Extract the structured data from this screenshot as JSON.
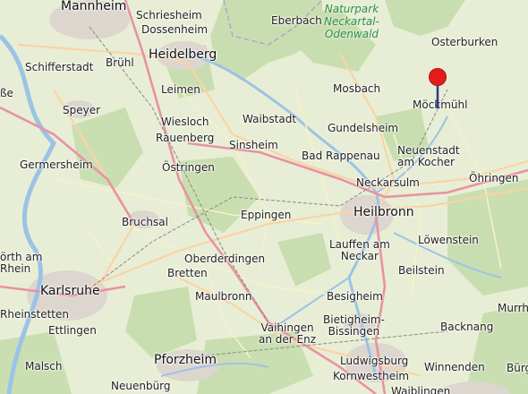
{
  "places": {
    "mannheim": "Mannheim",
    "schriesheim": "Schriesheim",
    "dossenheim": "Dossenheim",
    "eberbach": "Eberbach",
    "osterburken": "Osterburken",
    "heidelberg": "Heidelberg",
    "schifferstadt": "Schifferstadt",
    "bruehl": "Brühl",
    "leimen": "Leimen",
    "mosbach": "Mosbach",
    "moeckmuehl": "Möckmühl",
    "speyer": "Speyer",
    "wiesloch": "Wiesloch",
    "waibstadt": "Waibstadt",
    "gundelsheim": "Gundelsheim",
    "rauenberg": "Rauenberg",
    "sinsheim": "Sinsheim",
    "neuenstadt_1": "Neuenstadt",
    "neuenstadt_2": "am Kocher",
    "germersheim": "Germersheim",
    "oestringen": "Östringen",
    "bad_rappenau": "Bad Rappenau",
    "oehringen": "Öhringen",
    "neckarsulm": "Neckarsulm",
    "bruchsal": "Bruchsal",
    "eppingen": "Eppingen",
    "heilbronn": "Heilbronn",
    "loewenstein": "Löwenstein",
    "lauffen_1": "Lauffen am",
    "lauffen_2": "Neckar",
    "oberderdingen": "Oberderdingen",
    "woerth_1": "örth am",
    "woerth_2": "Rhein",
    "bretten": "Bretten",
    "beilstein": "Beilstein",
    "karlsruhe": "Karlsruhe",
    "maulbronn": "Maulbronn",
    "besigheim": "Besigheim",
    "murrhardt": "Murrh",
    "rheinstetten": "Rheinstetten",
    "bietigheim_1": "Bietigheim-",
    "bietigheim_2": "Bissingen",
    "ettlingen": "Ettlingen",
    "vaihingen_1": "Vaihingen",
    "vaihingen_2": "an der Enz",
    "backnang": "Backnang",
    "malsch": "Malsch",
    "pforzheim": "Pforzheim",
    "ludwigsburg": "Ludwigsburg",
    "winnenden": "Winnenden",
    "neuenbuerg": "Neuenbürg",
    "kornwestheim": "Kornwestheim",
    "waiblingen": "Waiblingen",
    "burg": "Bürg",
    "sse": "ße",
    "park_1": "Naturpark",
    "park_2": "Neckartal-",
    "park_3": "Odenwald"
  },
  "marker": {
    "place": "Möckmühl",
    "color": "#e41a1c",
    "icon": "map-pin-icon"
  }
}
